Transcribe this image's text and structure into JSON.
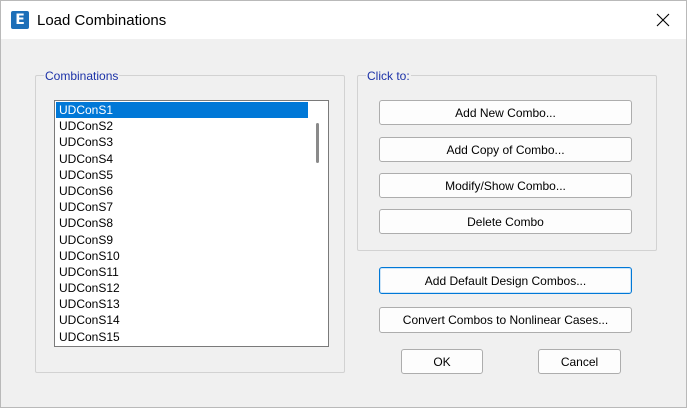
{
  "window": {
    "title": "Load Combinations",
    "app_icon_letter": "E"
  },
  "combinations": {
    "label": "Combinations",
    "selected_index": 0,
    "items": [
      "UDConS1",
      "UDConS2",
      "UDConS3",
      "UDConS4",
      "UDConS5",
      "UDConS6",
      "UDConS7",
      "UDConS8",
      "UDConS9",
      "UDConS10",
      "UDConS11",
      "UDConS12",
      "UDConS13",
      "UDConS14",
      "UDConS15"
    ]
  },
  "click_to": {
    "label": "Click to:",
    "add_new": "Add New Combo...",
    "add_copy": "Add Copy of Combo...",
    "modify_show": "Modify/Show Combo...",
    "delete": "Delete Combo"
  },
  "actions": {
    "add_default": "Add Default Design Combos...",
    "convert": "Convert Combos to Nonlinear Cases...",
    "ok": "OK",
    "cancel": "Cancel"
  },
  "colors": {
    "selection": "#0078d7",
    "group_label": "#1c32a8",
    "app_icon": "#1d6fb8"
  }
}
